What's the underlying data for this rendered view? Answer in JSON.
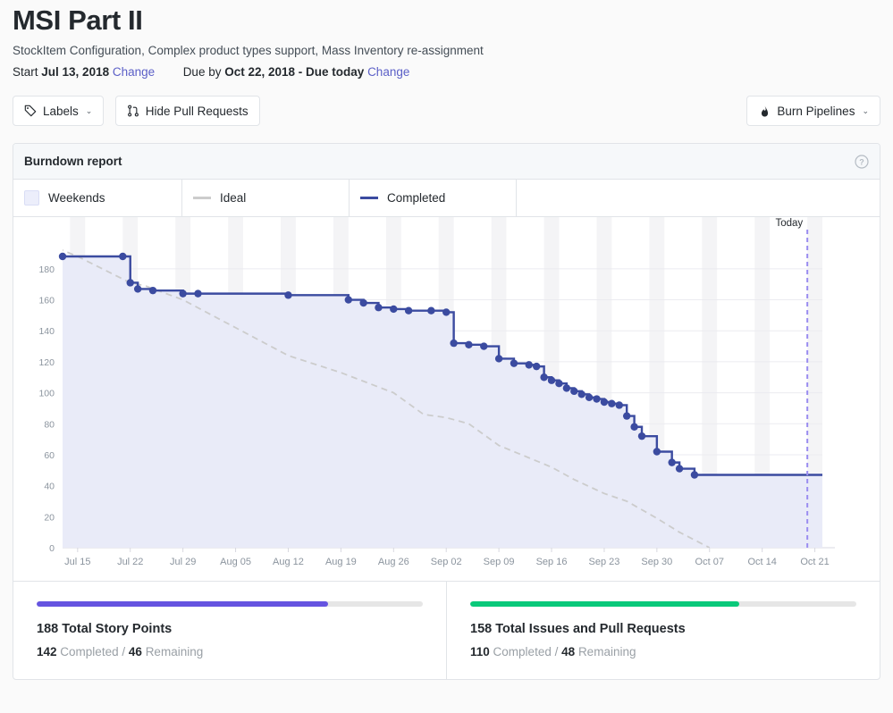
{
  "header": {
    "title": "MSI Part II",
    "subtitle": "StockItem Configuration, Complex product types support, Mass Inventory re-assignment",
    "start_label": "Start",
    "start_date": "Jul 13, 2018",
    "start_change": "Change",
    "due_label": "Due by",
    "due_date": "Oct 22, 2018 - Due today",
    "due_change": "Change"
  },
  "toolbar": {
    "labels_button": "Labels",
    "hide_pr_button": "Hide Pull Requests",
    "burn_pipelines_button": "Burn Pipelines",
    "caret": "⌄"
  },
  "card": {
    "heading": "Burndown report",
    "help_icon": "question-circle-icon"
  },
  "legend": [
    {
      "label": "Weekends",
      "type": "box",
      "color": "#eceefb"
    },
    {
      "label": "Ideal",
      "type": "line",
      "color": "#cccccc"
    },
    {
      "label": "Completed",
      "type": "line",
      "color": "#3b4ba0"
    }
  ],
  "summary": [
    {
      "title": "188 Total Story Points",
      "completed": "142",
      "completed_label": "Completed",
      "separator": "/",
      "remaining": "46",
      "remaining_label": "Remaining",
      "percent": 75.5,
      "color": "#6554e0"
    },
    {
      "title": "158 Total Issues and Pull Requests",
      "completed": "110",
      "completed_label": "Completed",
      "separator": "/",
      "remaining": "48",
      "remaining_label": "Remaining",
      "percent": 69.6,
      "color": "#0ac97a"
    }
  ],
  "chart_data": {
    "type": "line",
    "title": "Burndown report",
    "xlabel": "",
    "ylabel": "",
    "ylim": [
      0,
      188
    ],
    "yticks": [
      0,
      20,
      40,
      60,
      80,
      100,
      120,
      140,
      160,
      180
    ],
    "xlim": [
      "2018-07-13",
      "2018-10-22"
    ],
    "xticks": [
      "Jul 15",
      "Jul 22",
      "Jul 29",
      "Aug 05",
      "Aug 12",
      "Aug 19",
      "Aug 26",
      "Sep 02",
      "Sep 09",
      "Sep 16",
      "Sep 23",
      "Sep 30",
      "Oct 07",
      "Oct 14",
      "Oct 21"
    ],
    "grid": true,
    "legend_position": "top",
    "annotations": [
      {
        "label": "Today",
        "x": "2018-10-22",
        "style": "dashed-vertical",
        "color": "#9a8cf0"
      }
    ],
    "series": [
      {
        "name": "Completed",
        "color": "#3b4ba0",
        "style": "step",
        "fill": "#e9ebf8",
        "points": [
          {
            "day": 0,
            "value": 188
          },
          {
            "day": 8,
            "value": 188
          },
          {
            "day": 9,
            "value": 171
          },
          {
            "day": 10,
            "value": 167
          },
          {
            "day": 12,
            "value": 166
          },
          {
            "day": 16,
            "value": 164
          },
          {
            "day": 18,
            "value": 164
          },
          {
            "day": 30,
            "value": 163
          },
          {
            "day": 38,
            "value": 160
          },
          {
            "day": 40,
            "value": 158
          },
          {
            "day": 42,
            "value": 155
          },
          {
            "day": 44,
            "value": 154
          },
          {
            "day": 46,
            "value": 153
          },
          {
            "day": 49,
            "value": 153
          },
          {
            "day": 51,
            "value": 152
          },
          {
            "day": 52,
            "value": 132
          },
          {
            "day": 54,
            "value": 131
          },
          {
            "day": 56,
            "value": 130
          },
          {
            "day": 58,
            "value": 122
          },
          {
            "day": 60,
            "value": 119
          },
          {
            "day": 62,
            "value": 118
          },
          {
            "day": 63,
            "value": 117
          },
          {
            "day": 64,
            "value": 110
          },
          {
            "day": 65,
            "value": 108
          },
          {
            "day": 66,
            "value": 106
          },
          {
            "day": 67,
            "value": 103
          },
          {
            "day": 68,
            "value": 101
          },
          {
            "day": 69,
            "value": 99
          },
          {
            "day": 70,
            "value": 97
          },
          {
            "day": 71,
            "value": 96
          },
          {
            "day": 72,
            "value": 94
          },
          {
            "day": 73,
            "value": 93
          },
          {
            "day": 74,
            "value": 92
          },
          {
            "day": 75,
            "value": 85
          },
          {
            "day": 76,
            "value": 78
          },
          {
            "day": 77,
            "value": 72
          },
          {
            "day": 79,
            "value": 62
          },
          {
            "day": 81,
            "value": 55
          },
          {
            "day": 82,
            "value": 51
          },
          {
            "day": 84,
            "value": 47
          }
        ]
      },
      {
        "name": "Ideal",
        "color": "#cccccc",
        "style": "dashed",
        "points": [
          {
            "day": -2,
            "value": 196
          },
          {
            "day": 2,
            "value": 188
          },
          {
            "day": 9,
            "value": 171
          },
          {
            "day": 11,
            "value": 169
          },
          {
            "day": 16,
            "value": 160
          },
          {
            "day": 23,
            "value": 142
          },
          {
            "day": 30,
            "value": 124
          },
          {
            "day": 37,
            "value": 113
          },
          {
            "day": 44,
            "value": 100
          },
          {
            "day": 48,
            "value": 86
          },
          {
            "day": 51,
            "value": 84
          },
          {
            "day": 54,
            "value": 80
          },
          {
            "day": 58,
            "value": 66
          },
          {
            "day": 61,
            "value": 60
          },
          {
            "day": 65,
            "value": 52
          },
          {
            "day": 68,
            "value": 44
          },
          {
            "day": 72,
            "value": 35
          },
          {
            "day": 75,
            "value": 30
          },
          {
            "day": 79,
            "value": 19
          },
          {
            "day": 82,
            "value": 10
          },
          {
            "day": 86,
            "value": 0
          }
        ]
      }
    ]
  }
}
